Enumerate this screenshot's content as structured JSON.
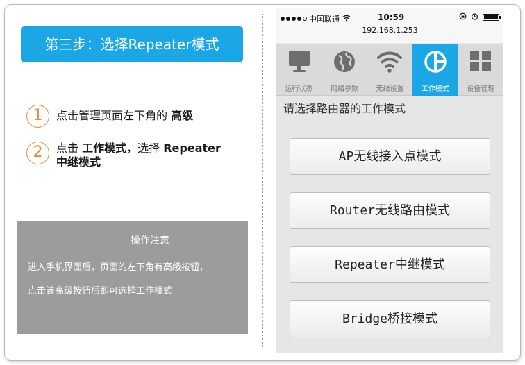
{
  "left": {
    "step_title": "第三步：选择Repeater模式",
    "steps": [
      {
        "num": "1",
        "text": "点击管理页面左下角的",
        "bold": "高级"
      },
      {
        "num": "2",
        "text": "点击",
        "bold": "工作模式",
        "text2": "，选择",
        "bold2": "Repeater",
        "bold3": "中继模式"
      }
    ],
    "notice": {
      "title": "操作注意",
      "line1": "进入手机界面后，页面的左下角有高级按钮，",
      "line2": "点击该高级按钮后即可选择工作模式"
    }
  },
  "phone": {
    "status": {
      "carrier": "中国联通",
      "time": "10:59",
      "url": "192.168.1.253"
    },
    "tabs": [
      {
        "label": "运行状态",
        "icon": "monitor-icon"
      },
      {
        "label": "网络参数",
        "icon": "globe-icon"
      },
      {
        "label": "无线设置",
        "icon": "wifi-icon"
      },
      {
        "label": "工作模式",
        "icon": "mode-icon",
        "active": true
      },
      {
        "label": "设备管理",
        "icon": "grid-icon"
      }
    ],
    "prompt": "请选择路由器的工作模式",
    "modes": [
      "AP无线接入点模式",
      "Router无线路由模式",
      "Repeater中继模式",
      "Bridge桥接模式"
    ]
  },
  "colors": {
    "accent": "#1ba7e6",
    "step_number": "#e98a3a",
    "notice_bg": "#9c9c9c"
  }
}
